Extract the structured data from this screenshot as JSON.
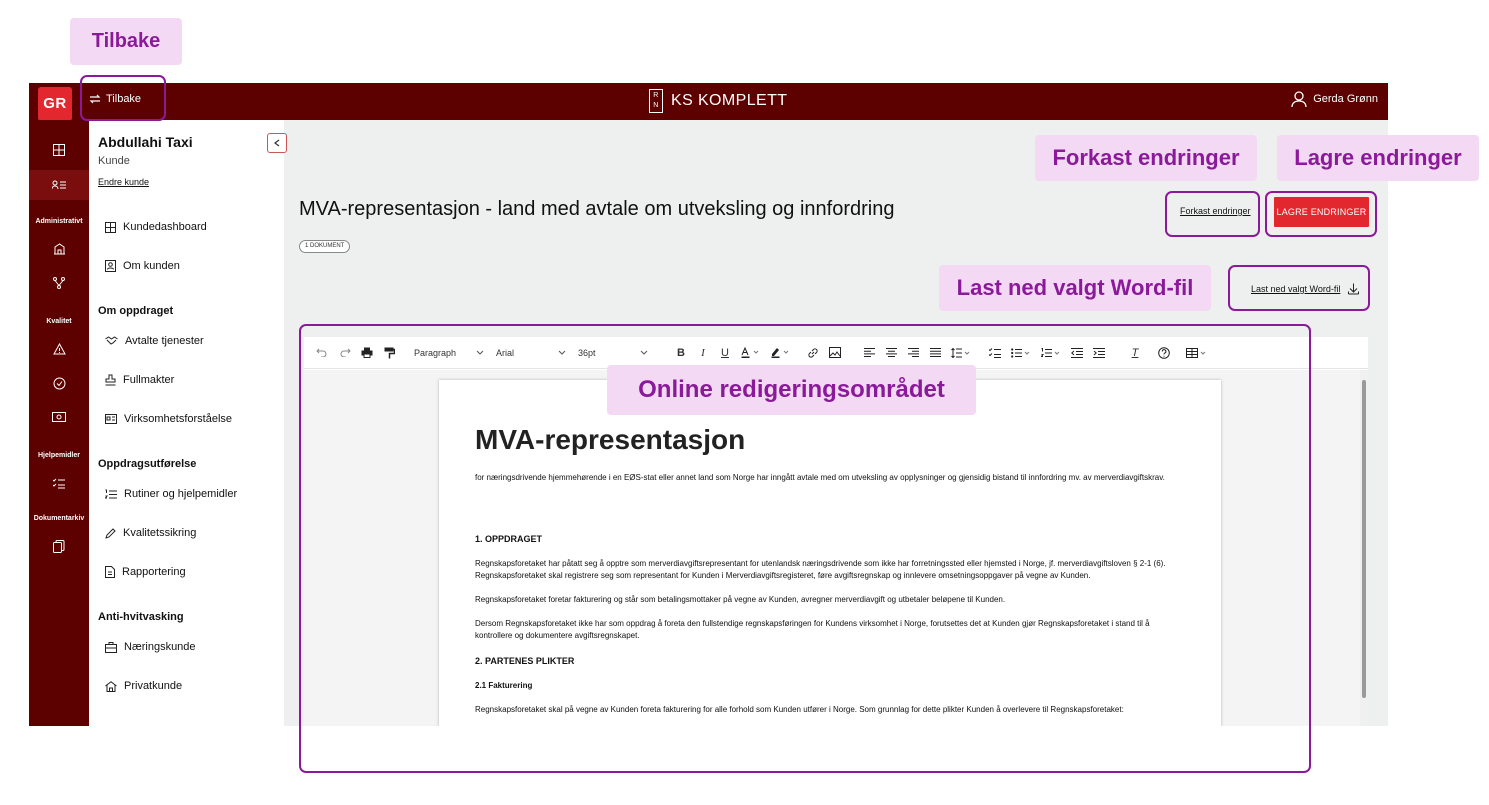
{
  "annotations": {
    "back": "Tilbake",
    "discard": "Forkast endringer",
    "save": "Lagre endringer",
    "download": "Last ned valgt Word-fil",
    "editor": "Online redigeringsområdet"
  },
  "topbar": {
    "logo": "GR",
    "back_label": "Tilbake",
    "brand_mark": "R N",
    "brand_name": "KS KOMPLETT",
    "user_name": "Gerda Grønn"
  },
  "rail": {
    "sections": [
      "Administrativt",
      "Kvalitet",
      "Hjelpemidler",
      "Dokumentarkiv"
    ]
  },
  "customer": {
    "name": "Abdullahi Taxi",
    "type": "Kunde",
    "change_label": "Endre kunde"
  },
  "sidebar": {
    "items": [
      {
        "label": "Kundedashboard",
        "icon": "dashboard-icon"
      },
      {
        "label": "Om kunden",
        "icon": "contact-icon"
      },
      {
        "label": "Avtalte tjenester",
        "icon": "handshake-icon"
      },
      {
        "label": "Fullmakter",
        "icon": "stamp-icon"
      },
      {
        "label": "Virksomhetsforståelse",
        "icon": "id-card-icon"
      },
      {
        "label": "Rutiner og hjelpemidler",
        "icon": "list-ordered-icon"
      },
      {
        "label": "Kvalitetssikring",
        "icon": "pencil-icon"
      },
      {
        "label": "Rapportering",
        "icon": "document-icon"
      },
      {
        "label": "Næringskunde",
        "icon": "briefcase-icon"
      },
      {
        "label": "Privatkunde",
        "icon": "house-icon"
      }
    ],
    "headings": [
      "Om oppdraget",
      "Oppdragsutførelse",
      "Anti-hvitvasking"
    ]
  },
  "document": {
    "title": "MVA-representasjon - land med avtale om utveksling og innfordring",
    "badge": "1 DOKUMENT",
    "discard_label": "Forkast endringer",
    "save_label": "LAGRE ENDRINGER",
    "download_label": "Last ned valgt Word-fil"
  },
  "toolbar": {
    "block_format": "Paragraph",
    "font_family": "Arial",
    "font_size": "36pt"
  },
  "paper": {
    "heading": "MVA-representasjon",
    "intro": "for næringsdrivende hjemmehørende i en EØS-stat eller annet land som Norge har inngått avtale med om utveksling av opplysninger og gjensidig bistand til innfordring mv. av merverdiavgiftskrav.",
    "section1": "1.  OPPDRAGET",
    "p1": "Regnskapsforetaket har påtatt seg å opptre som merverdiavgiftsrepresentant for utenlandsk næringsdrivende som ikke har forretningssted eller hjemsted i Norge, jf. merverdiavgiftsloven § 2-1 (6). Regnskapsforetaket skal registrere seg som representant for Kunden i Merverdiavgiftsregisteret, føre avgiftsregnskap og innlevere omsetningsoppgaver på vegne av Kunden.",
    "p2": "Regnskapsforetaket foretar fakturering og står som betalingsmottaker på vegne av Kunden, avregner merverdiavgift og utbetaler beløpene til Kunden.",
    "p3": "Dersom Regnskapsforetaket ikke har som oppdrag å foreta den fullstendige regnskapsføringen for Kundens virksomhet i Norge, forutsettes det at Kunden gjør Regnskapsforetaket i stand til å kontrollere og dokumentere avgiftsregnskapet.",
    "section2": "2.  PARTENES PLIKTER",
    "section21": "2.1    Fakturering",
    "p4": "Regnskapsforetaket skal på vegne av Kunden foreta fakturering for alle forhold som Kunden utfører i Norge. Som grunnlag for dette plikter Kunden å overlevere til Regnskapsforetaket:"
  },
  "colors": {
    "brand_dark": "#5c0000",
    "accent_red": "#e2282e",
    "annotation_purple": "#8b1a9b",
    "annotation_bg": "#f3d9f3"
  }
}
